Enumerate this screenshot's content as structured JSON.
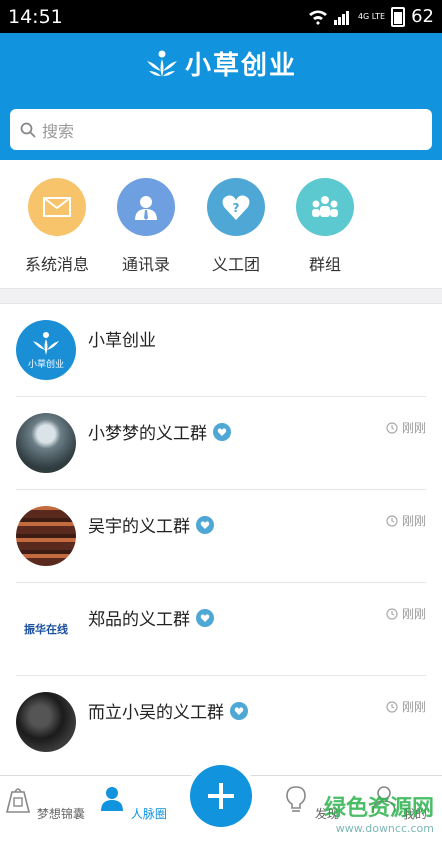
{
  "status": {
    "time": "14:51",
    "network": "4G LTE",
    "battery": "62"
  },
  "header": {
    "brand": "小草创业",
    "search_placeholder": "搜索"
  },
  "quick_actions": [
    {
      "label": "系统消息",
      "icon": "mail-icon",
      "color": "#f7c46c"
    },
    {
      "label": "通讯录",
      "icon": "contact-icon",
      "color": "#6e9fe0"
    },
    {
      "label": "义工团",
      "icon": "heart-shield-icon",
      "color": "#4fa7d6"
    },
    {
      "label": "群组",
      "icon": "group-icon",
      "color": "#5cc8cf"
    }
  ],
  "list": [
    {
      "title": "小草创业",
      "time": "",
      "badge": false,
      "avatar_text": "小草创业"
    },
    {
      "title": "小梦梦的义工群",
      "time": "刚刚",
      "badge": true
    },
    {
      "title": "吴宇的义工群",
      "time": "刚刚",
      "badge": true
    },
    {
      "title": "郑品的义工群",
      "time": "刚刚",
      "badge": true,
      "avatar_text": "振华在线"
    },
    {
      "title": "而立小吴的义工群",
      "time": "刚刚",
      "badge": true
    }
  ],
  "tabs": [
    {
      "label": "梦想锦囊",
      "icon": "bag-icon"
    },
    {
      "label": "人脉圈",
      "icon": "people-icon"
    },
    {
      "label": "发现",
      "icon": "bulb-icon"
    },
    {
      "label": "我的",
      "icon": "person-icon"
    }
  ],
  "watermark": {
    "main": "绿色资源网",
    "sub": "www.downcc.com"
  }
}
